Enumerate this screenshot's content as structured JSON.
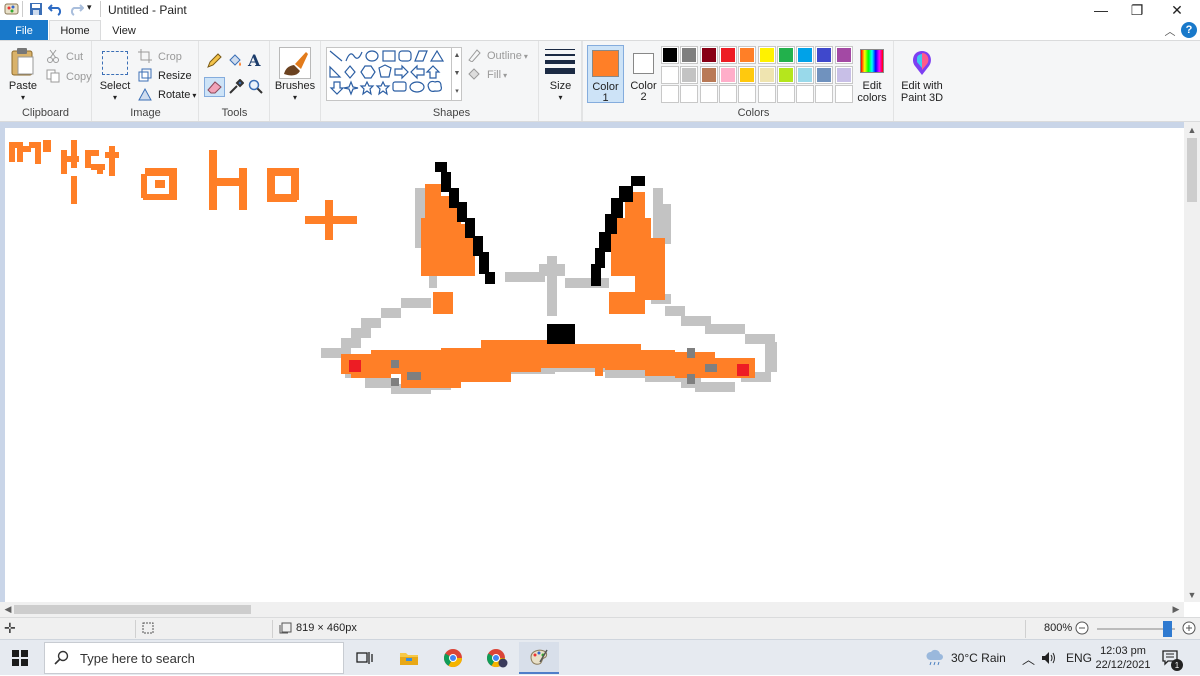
{
  "window": {
    "title": "Untitled - Paint",
    "minimize": "—",
    "restore": "❐",
    "close": "✕",
    "collapse_ribbon": "︿",
    "help": "?"
  },
  "tabs": {
    "file": "File",
    "home": "Home",
    "view": "View"
  },
  "clipboard": {
    "paste": "Paste",
    "cut": "Cut",
    "copy": "Copy",
    "label": "Clipboard"
  },
  "image": {
    "select": "Select",
    "crop": "Crop",
    "resize": "Resize",
    "rotate": "Rotate",
    "label": "Image"
  },
  "tools": {
    "label": "Tools"
  },
  "brushes": {
    "label": "Brushes"
  },
  "shapes": {
    "outline": "Outline",
    "fill": "Fill",
    "label": "Shapes"
  },
  "size": {
    "label": "Size"
  },
  "colors": {
    "color1_label": "Color",
    "color1_num": "1",
    "color2_label": "Color",
    "color2_num": "2",
    "color1": "#ff7f27",
    "color2": "#ffffff",
    "edit_colors_1": "Edit",
    "edit_colors_2": "colors",
    "edit_3d_1": "Edit with",
    "edit_3d_2": "Paint 3D",
    "label": "Colors",
    "palette_row1": [
      "#000000",
      "#7f7f7f",
      "#880015",
      "#ed1c24",
      "#ff7f27",
      "#fff200",
      "#22b14c",
      "#00a2e8",
      "#3f48cc",
      "#a349a4"
    ],
    "palette_row2": [
      "#ffffff",
      "#c3c3c3",
      "#b97a57",
      "#ffaec9",
      "#ffc90e",
      "#efe4b0",
      "#b5e61d",
      "#99d9ea",
      "#7092be",
      "#c8bfe7"
    ]
  },
  "status": {
    "dimensions": "819 × 460px",
    "zoom": "800%"
  },
  "taskbar": {
    "search_placeholder": "Type here to search",
    "weather": "30°C  Rain",
    "lang": "ENG",
    "time": "12:03 pm",
    "date": "22/12/2021",
    "notifications": "1"
  },
  "drawing": {
    "orange": "#ff7f27",
    "grey": "#c3c3c3",
    "black": "#000000",
    "red": "#ed1c24",
    "darkgrey": "#7f7f7f"
  }
}
